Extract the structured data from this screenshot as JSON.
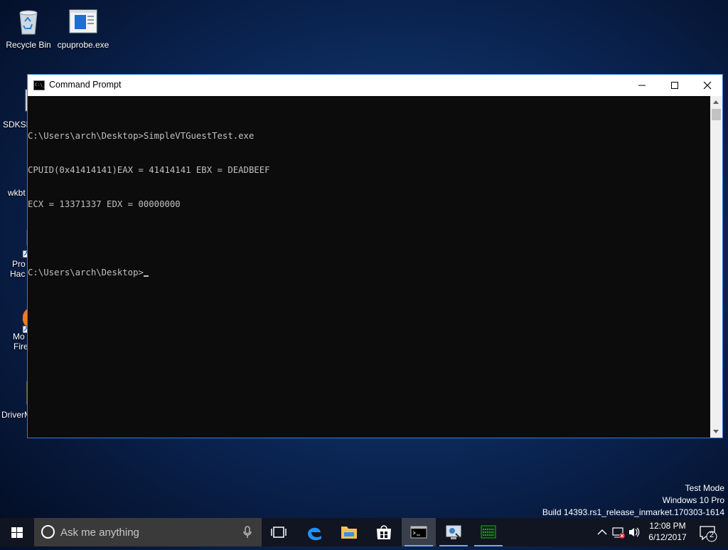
{
  "desktop": {
    "icons": [
      {
        "label": "Recycle Bin"
      },
      {
        "label": "cpuprobe.exe"
      },
      {
        "label": "SDKSE"
      },
      {
        "label": "wkbt"
      },
      {
        "label": "Pro"
      },
      {
        "label": "Hac"
      },
      {
        "label": "Mo"
      },
      {
        "label": "Fire"
      },
      {
        "label": "DriverM"
      }
    ]
  },
  "window": {
    "title": "Command Prompt",
    "console_lines": [
      "C:\\Users\\arch\\Desktop>SimpleVTGuestTest.exe",
      "CPUID(0x41414141)EAX = 41414141 EBX = DEADBEEF",
      "ECX = 13371337 EDX = 00000000",
      "",
      "C:\\Users\\arch\\Desktop>"
    ]
  },
  "watermark": {
    "line1": "Test Mode",
    "line2": "Windows 10 Pro",
    "line3": "Build 14393.rs1_release_inmarket.170303-1614"
  },
  "taskbar": {
    "search_placeholder": "Ask me anything",
    "clock_time": "12:08 PM",
    "clock_date": "6/12/2017",
    "notification_count": "2"
  },
  "colors": {
    "accent": "#3b7bd1",
    "console_bg": "#0c0c0c",
    "console_text": "#c0c0c0"
  }
}
